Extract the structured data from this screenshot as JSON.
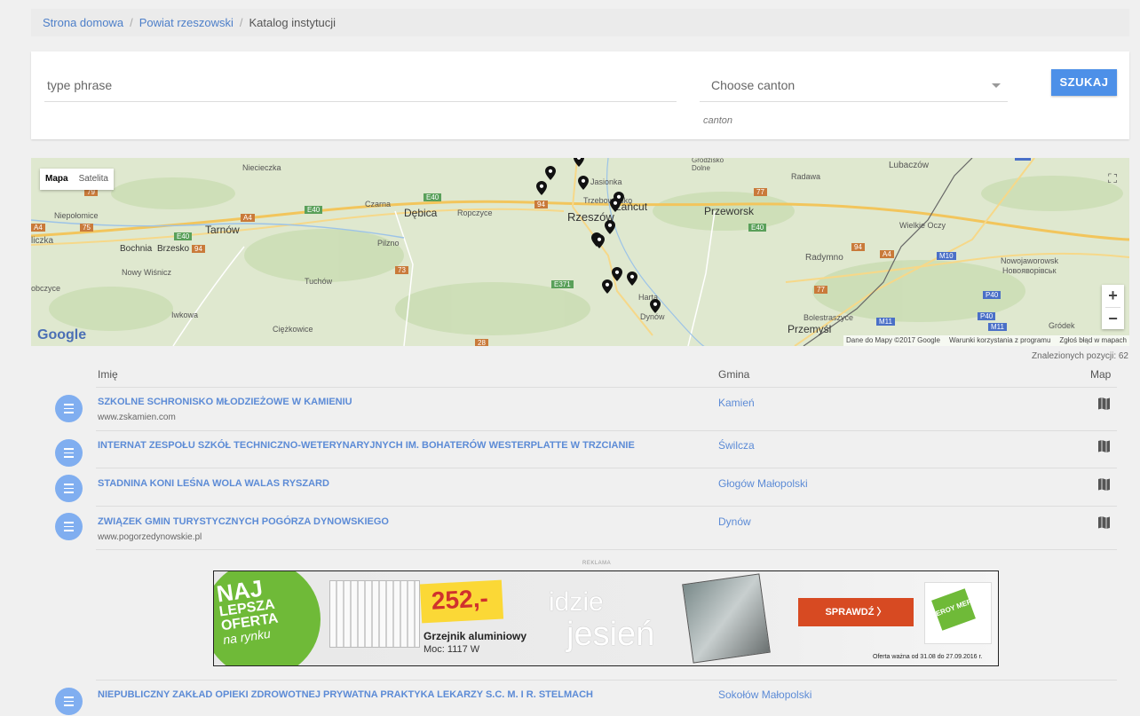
{
  "breadcrumb": {
    "home": "Strona domowa",
    "region": "Powiat rzeszowski",
    "current": "Katalog instytucji",
    "separator": "/"
  },
  "search": {
    "phrase_placeholder": "type phrase",
    "canton_placeholder": "Choose canton",
    "canton_hint": "canton",
    "button_label": "SZUKAJ"
  },
  "map": {
    "type_map": "Mapa",
    "type_satellite": "Satelita",
    "zoom_in": "+",
    "zoom_out": "−",
    "logo": "Google",
    "footer_data": "Dane do Mapy ©2017 Google",
    "footer_terms": "Warunki korzystania z programu",
    "footer_report": "Zgłoś błąd w mapach",
    "labels": {
      "niecieczka": "Niecieczka",
      "czarna": "Czarna",
      "debica": "Dębica",
      "ropczyce": "Ropczyce",
      "rzeszow": "Rzeszów",
      "lancut": "Łańcut",
      "przeworsk": "Przeworsk",
      "jasionka": "Jasionka",
      "trzebownisko": "Trzebownisko",
      "niepolomice": "Niepołomice",
      "bochnia": "Bochnia",
      "brzesko": "Brzesko",
      "tarnow": "Tarnów",
      "pilzno": "Pilzno",
      "nowy_wisnicz": "Nowy Wiśnicz",
      "tuchow": "Tuchów",
      "iwkowa": "Iwkowa",
      "ciezkowice": "Ciężkowice",
      "radawa": "Radawa",
      "lubaczow": "Lubaczów",
      "wielkie_oczy": "Wielkie Oczy",
      "radymno": "Radymno",
      "nowojaworowsk": "Nowojaworowsk",
      "nowojaworowsk_cyr": "Новояворівськ",
      "bolestraszyce": "Bolestraszyce",
      "przemysl": "Przemyśl",
      "grodek": "Gródek",
      "dynow": "Dynów",
      "harta": "Harta",
      "grodzisko": "Grodzisko Dolne",
      "liczka": "liczka",
      "obczyce": "obczyce"
    },
    "road_numbers": [
      "79",
      "75",
      "E40",
      "E40",
      "E40",
      "E40",
      "94",
      "94",
      "73",
      "E371",
      "77",
      "94",
      "M10",
      "77",
      "P40",
      "P40",
      "M11",
      "M11",
      "28",
      "A4",
      "A4",
      "A4"
    ]
  },
  "results": {
    "count_label": "Znalezionych pozycji: 62",
    "headers": {
      "name": "Imię",
      "gmina": "Gmina",
      "map": "Map"
    },
    "items": [
      {
        "title": "SZKOLNE SCHRONISKO MŁODZIEŻOWE W KAMIENIU",
        "url": "www.zskamien.com",
        "gmina": "Kamień"
      },
      {
        "title": "INTERNAT ZESPOŁU SZKÓŁ TECHNICZNO-WETERYNARYJNYCH IM. BOHATERÓW WESTERPLATTE W TRZCIANIE",
        "url": "",
        "gmina": "Świlcza"
      },
      {
        "title": "STADNINA KONI LEŚNA WOLA WALAS RYSZARD",
        "url": "",
        "gmina": "Głogów Małopolski"
      },
      {
        "title": "ZWIĄZEK GMIN TURYSTYCZNYCH POGÓRZA DYNOWSKIEGO",
        "url": "www.pogorzedynowskie.pl",
        "gmina": "Dynów"
      },
      {
        "title": "NIEPUBLICZNY ZAKŁAD OPIEKI ZDROWOTNEJ PRYWATNA PRAKTYKA LEKARZY S.C. M. I R. STELMACH",
        "url": "",
        "gmina": "Sokołów Małopolski"
      }
    ]
  },
  "ad": {
    "label": "REKLAMA",
    "badge_line1": "NAJ",
    "badge_line2": "LEPSZA",
    "badge_line3": "OFERTA",
    "badge_line4": "na rynku",
    "price": "252,-",
    "product": "Grzejnik aluminiowy",
    "spec": "Moc: 1117 W",
    "slogan1": "idzie",
    "slogan2": "jesień",
    "cta": "SPRAWDŹ  〉",
    "brand": "LEROY MERLIN",
    "validity": "Oferta ważna od  31.08 do 27.09.2016 r."
  },
  "colors": {
    "accent": "#4d90e8",
    "link": "#5c8bd6",
    "icon_bg": "#80aef0",
    "ad_green": "#6fba38",
    "ad_orange": "#d74a22"
  }
}
